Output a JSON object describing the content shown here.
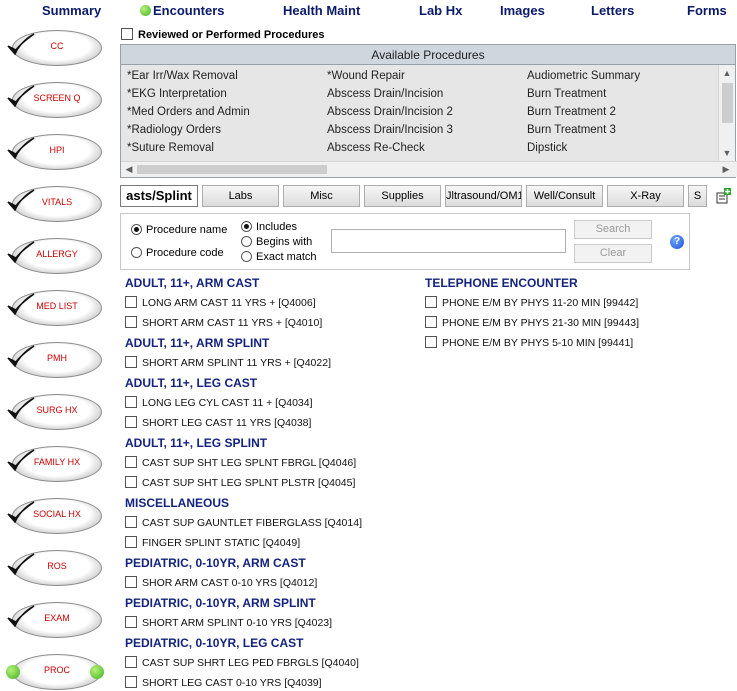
{
  "nav": {
    "summary": "Summary",
    "encounters": "Encounters",
    "health_maint": "Health Maint",
    "lab_hx": "Lab Hx",
    "images": "Images",
    "letters": "Letters",
    "forms": "Forms"
  },
  "sidebar": {
    "items": [
      {
        "label": "CC"
      },
      {
        "label": "SCREEN Q"
      },
      {
        "label": "HPI"
      },
      {
        "label": "VITALS"
      },
      {
        "label": "ALLERGY"
      },
      {
        "label": "MED LIST"
      },
      {
        "label": "PMH"
      },
      {
        "label": "SURG HX"
      },
      {
        "label": "FAMILY HX"
      },
      {
        "label": "SOCIAL HX"
      },
      {
        "label": "ROS"
      },
      {
        "label": "EXAM"
      },
      {
        "label": "PROC"
      }
    ]
  },
  "reviewed_label": "Reviewed or Performed Procedures",
  "available": {
    "header": "Available Procedures",
    "col1": [
      "*Ear Irr/Wax Removal",
      "*EKG Interpretation",
      "*Med Orders and Admin",
      "*Radiology Orders",
      "*Suture Removal"
    ],
    "col2": [
      "*Wound Repair",
      "Abscess Drain/Incision",
      "Abscess Drain/Incision 2",
      "Abscess Drain/Incision 3",
      "Abscess Re-Check"
    ],
    "col3": [
      "Audiometric Summary",
      "Burn Treatment",
      "Burn Treatment 2",
      "Burn Treatment 3",
      "Dipstick"
    ]
  },
  "tabs": [
    "asts/Splint",
    "Labs",
    "Misc",
    "Supplies",
    "Jltrasound/OM1",
    "Well/Consult",
    "X-Ray",
    "S"
  ],
  "search": {
    "procedure_name": "Procedure name",
    "procedure_code": "Procedure code",
    "includes": "Includes",
    "begins_with": "Begins with",
    "exact_match": "Exact match",
    "search_button": "Search",
    "clear_button": "Clear",
    "input_value": ""
  },
  "groups_left": [
    {
      "title": "ADULT, 11+, ARM CAST",
      "items": [
        "LONG ARM CAST 11 YRS + [Q4006]",
        "SHORT ARM CAST 11 YRS + [Q4010]"
      ]
    },
    {
      "title": "ADULT, 11+, ARM SPLINT",
      "items": [
        "SHORT ARM SPLINT 11 YRS + [Q4022]"
      ]
    },
    {
      "title": "ADULT, 11+, LEG CAST",
      "items": [
        "LONG LEG CYL CAST 11 + [Q4034]",
        "SHORT LEG CAST 11 YRS [Q4038]"
      ]
    },
    {
      "title": "ADULT, 11+, LEG SPLINT",
      "items": [
        "CAST SUP SHT LEG SPLNT FBRGL [Q4046]",
        "CAST SUP SHT LEG SPLNT PLSTR [Q4045]"
      ]
    },
    {
      "title": "MISCELLANEOUS",
      "items": [
        "CAST SUP GAUNTLET FIBERGLASS [Q4014]",
        "FINGER SPLINT  STATIC [Q4049]"
      ]
    },
    {
      "title": "PEDIATRIC, 0-10YR, ARM CAST",
      "items": [
        "SHOR ARM CAST 0-10 YRS [Q4012]"
      ]
    },
    {
      "title": "PEDIATRIC, 0-10YR, ARM SPLINT",
      "items": [
        "SHORT ARM SPLINT 0-10 YRS [Q4023]"
      ]
    },
    {
      "title": "PEDIATRIC, 0-10YR, LEG CAST",
      "items": [
        "CAST SUP SHRT LEG PED FBRGLS [Q4040]",
        "SHORT LEG CAST 0-10 YRS [Q4039]"
      ]
    }
  ],
  "groups_right": [
    {
      "title": "TELEPHONE ENCOUNTER",
      "items": [
        "PHONE E/M BY PHYS 11-20 MIN [99442]",
        "PHONE E/M BY PHYS 21-30 MIN [99443]",
        "PHONE E/M BY PHYS 5-10 MIN [99441]"
      ]
    }
  ],
  "colors": {
    "nav_text": "#0b1a6b",
    "group_title": "#13237e",
    "sidebar_label": "#cc0000",
    "active_green": "#3fb21a"
  }
}
